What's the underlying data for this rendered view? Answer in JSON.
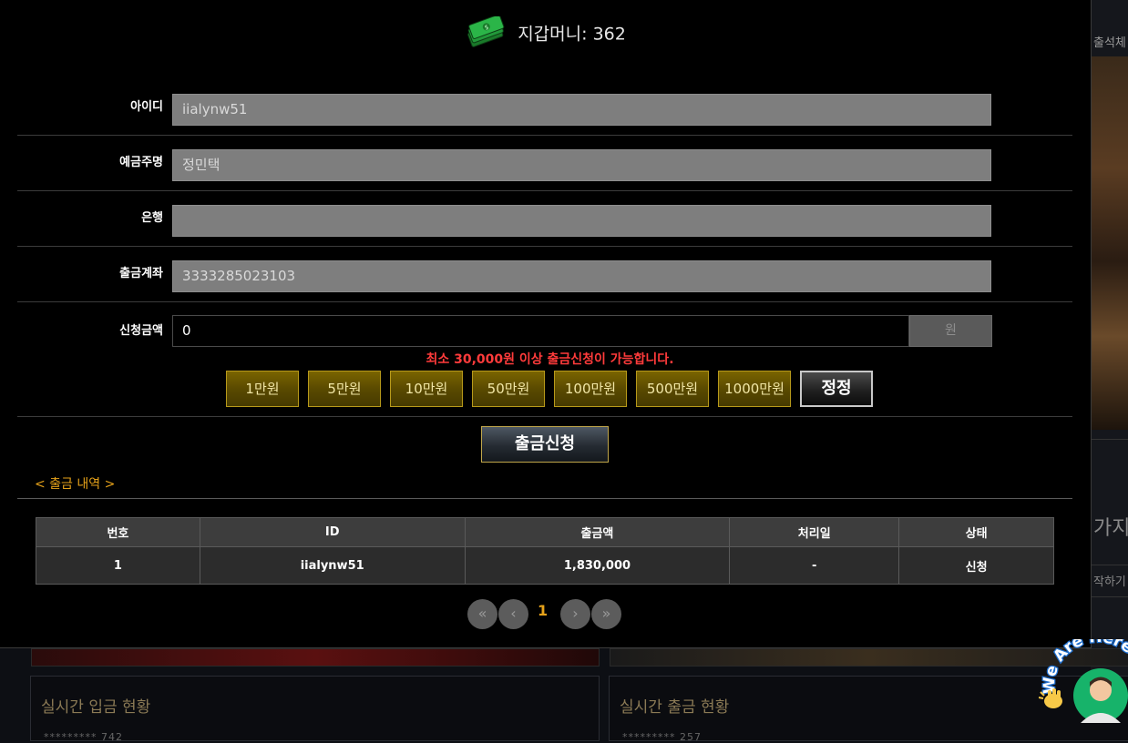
{
  "background": {
    "right_top_text": "출석체",
    "right_mid_text": "가지",
    "right_sub_text": "작하기",
    "deposit_panel_title": "실시간 입금 현황",
    "withdraw_panel_title": "실시간 출금 현황",
    "deposit_panel_dots": "*********  742",
    "withdraw_panel_dots": "*********  257"
  },
  "wallet": {
    "icon": "money-stack-icon",
    "label": "지갑머니: 362"
  },
  "form": {
    "id_label": "아이디",
    "id_value": "iialynw51",
    "holder_label": "예금주명",
    "holder_value": "정민택",
    "bank_label": "은행",
    "bank_value": "",
    "account_label": "출금계좌",
    "account_value": "3333285023103",
    "amount_label": "신청금액",
    "amount_value": "0",
    "amount_unit": "원",
    "notice": "최소 30,000원 이상 출금신청이 가능합니다."
  },
  "amount_buttons": [
    "1만원",
    "5만원",
    "10만원",
    "50만원",
    "100만원",
    "500만원",
    "1000만원"
  ],
  "reset_label": "정정",
  "submit_label": "출금신청",
  "history_link": "< 출금 내역 >",
  "history_table": {
    "headers": [
      "번호",
      "ID",
      "출금액",
      "처리일",
      "상태"
    ],
    "rows": [
      [
        "1",
        "iialynw51",
        "1,830,000",
        "-",
        "신청"
      ]
    ]
  },
  "pagination": {
    "first": "«",
    "prev": "‹",
    "current": "1",
    "next": "›",
    "last": "»"
  },
  "mascot": {
    "text": "We Are Here",
    "icon": "waving-hand-icon"
  },
  "colors": {
    "gold_button": "#5a4a00",
    "gold_border": "#b89a1a",
    "notice_red": "#ff3b3b",
    "link_orange": "#e6a21a"
  }
}
